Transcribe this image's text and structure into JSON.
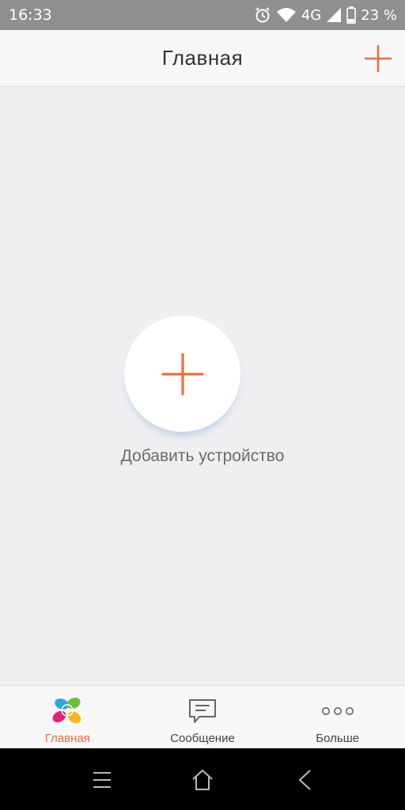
{
  "status_bar": {
    "time": "16:33",
    "network": "4G",
    "battery": "23 %",
    "icons": [
      "alarm-icon",
      "wifi-icon",
      "signal-icon",
      "battery-icon"
    ]
  },
  "header": {
    "title": "Главная",
    "add_icon": "plus-icon",
    "accent_color": "#ef6e3b"
  },
  "main": {
    "add_device_label": "Добавить устройство",
    "add_icon": "plus-icon"
  },
  "tabs": [
    {
      "label": "Главная",
      "icon": "ezviz-logo-icon",
      "active": true
    },
    {
      "label": "Сообщение",
      "icon": "message-icon",
      "active": false
    },
    {
      "label": "Больше",
      "icon": "more-dots-icon",
      "active": false
    }
  ],
  "nav_bar": {
    "buttons": [
      "menu-icon",
      "home-icon",
      "back-icon"
    ]
  }
}
